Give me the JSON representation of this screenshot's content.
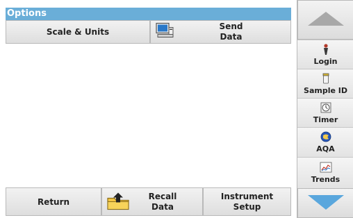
{
  "header": {
    "title": "Options"
  },
  "top_buttons": {
    "scale_units": "Scale & Units",
    "send_data_line1": "Send",
    "send_data_line2": "Data"
  },
  "bottom_buttons": {
    "return": "Return",
    "recall_line1": "Recall",
    "recall_line2": "Data",
    "instrument_line1": "Instrument",
    "instrument_line2": "Setup"
  },
  "sidebar": {
    "login": "Login",
    "sample_id": "Sample ID",
    "timer": "Timer",
    "aqa": "AQA",
    "trends": "Trends"
  },
  "colors": {
    "title_bar": "#6aaed8",
    "arrow": "#5aa7dd"
  }
}
